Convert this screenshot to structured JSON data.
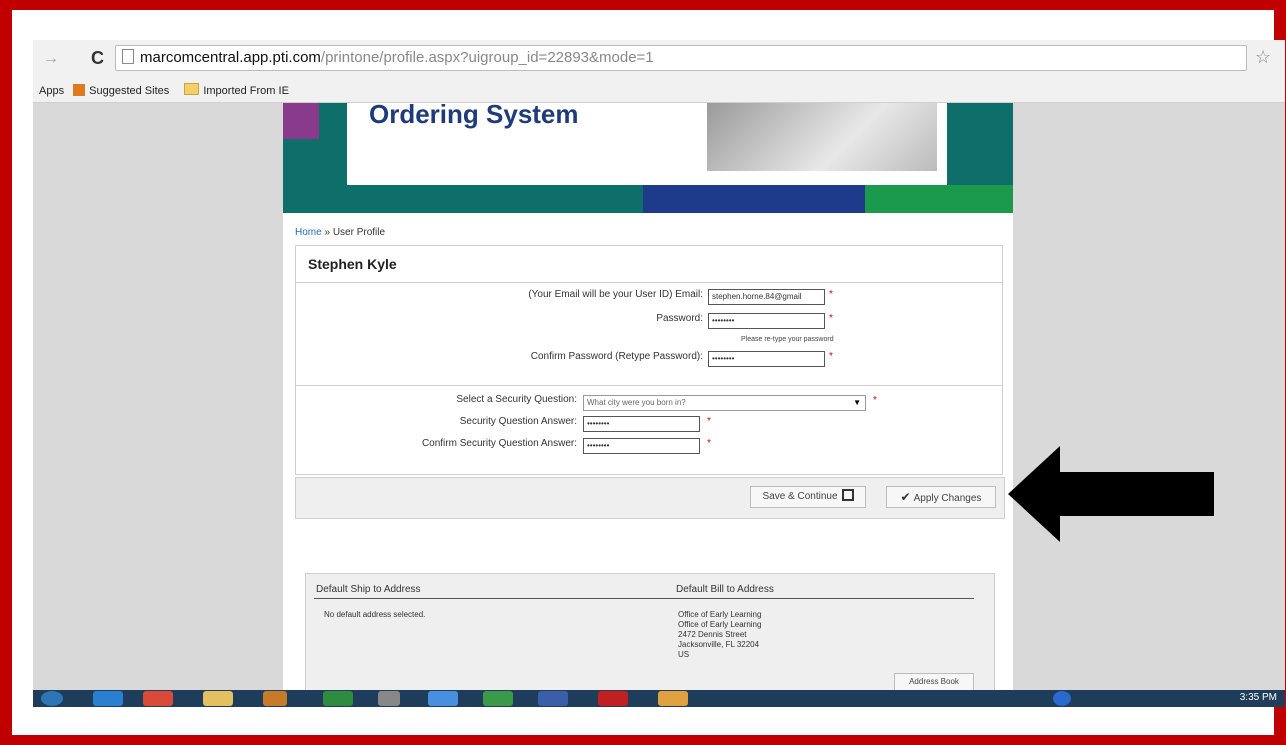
{
  "browser": {
    "url_host": "marcomcentral.app.pti.com",
    "url_path": "/printone/profile.aspx?uigroup_id=22893&mode=1",
    "bookmarks": [
      "Apps",
      "Suggested Sites",
      "Imported From IE"
    ]
  },
  "banner": {
    "title": "Ordering System"
  },
  "breadcrumb": {
    "home": "Home",
    "sep": "»",
    "current": "User Profile"
  },
  "profile": {
    "name": "Stephen Kyle",
    "email_label": "(Your Email will be your User ID) Email:",
    "email_value": "stephen.horne.84@gmail",
    "password_label": "Password:",
    "password_value": "••••••••",
    "password_hint": "Please re-type your password",
    "confirm_password_label": "Confirm Password (Retype Password):",
    "confirm_password_value": "••••••••",
    "security_question_label": "Select a Security Question:",
    "security_question_value": "What city were you born in?",
    "security_answer_label": "Security Question Answer:",
    "security_answer_value": "••••••••",
    "confirm_security_answer_label": "Confirm Security Question Answer:",
    "confirm_security_answer_value": "••••••••",
    "required_mark": "*"
  },
  "actions": {
    "save_continue": "Save & Continue",
    "apply_changes": "Apply Changes"
  },
  "addresses": {
    "ship_header": "Default Ship to Address",
    "bill_header": "Default Bill to Address",
    "ship_text": "No default address selected.",
    "bill_lines": [
      "Office of Early Learning",
      "Office of Early Learning",
      "2472 Dennis Street",
      "Jacksonville, FL 32204",
      "US"
    ],
    "address_book": "Address Book"
  },
  "taskbar": {
    "clock": "3:35 PM"
  },
  "colors": {
    "frame_red": "#c00000",
    "banner_teal": "#0e6e6a",
    "banner_text": "#1f3b7a"
  }
}
